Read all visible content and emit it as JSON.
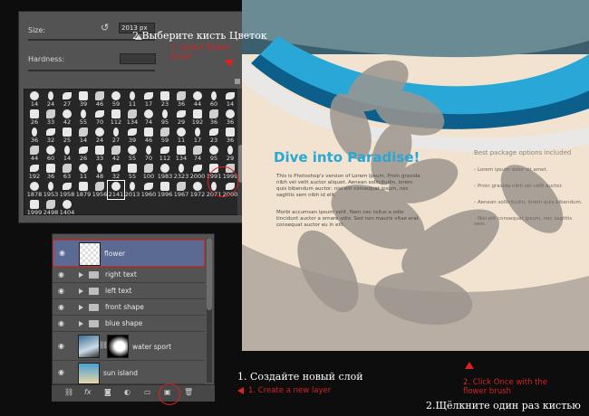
{
  "brush_panel": {
    "size_label": "Size:",
    "size_value": "2013 px",
    "hardness_label": "Hardness:",
    "brush_tips": [
      {
        "num": "14"
      },
      {
        "num": "24"
      },
      {
        "num": "27"
      },
      {
        "num": "39"
      },
      {
        "num": "46"
      },
      {
        "num": "59"
      },
      {
        "num": "11"
      },
      {
        "num": "17"
      },
      {
        "num": "23"
      },
      {
        "num": "36"
      },
      {
        "num": "44"
      },
      {
        "num": "60"
      },
      {
        "num": "14"
      },
      {
        "num": "26"
      },
      {
        "num": "33"
      },
      {
        "num": "42"
      },
      {
        "num": "55"
      },
      {
        "num": "70"
      },
      {
        "num": "112"
      },
      {
        "num": "134"
      },
      {
        "num": "74"
      },
      {
        "num": "95"
      },
      {
        "num": "29"
      },
      {
        "num": "192"
      },
      {
        "num": "36"
      },
      {
        "num": "36"
      },
      {
        "num": "36"
      },
      {
        "num": "32"
      },
      {
        "num": "25"
      },
      {
        "num": "14"
      },
      {
        "num": "24"
      },
      {
        "num": "27"
      },
      {
        "num": "39"
      },
      {
        "num": "46"
      },
      {
        "num": "59"
      },
      {
        "num": "11"
      },
      {
        "num": "17"
      },
      {
        "num": "23"
      },
      {
        "num": "36"
      },
      {
        "num": "44"
      },
      {
        "num": "60"
      },
      {
        "num": "14"
      },
      {
        "num": "26"
      },
      {
        "num": "33"
      },
      {
        "num": "42"
      },
      {
        "num": "55"
      },
      {
        "num": "70"
      },
      {
        "num": "112"
      },
      {
        "num": "134"
      },
      {
        "num": "74"
      },
      {
        "num": "95"
      },
      {
        "num": "29"
      },
      {
        "num": "192"
      },
      {
        "num": "36"
      },
      {
        "num": "63"
      },
      {
        "num": "11"
      },
      {
        "num": "48"
      },
      {
        "num": "32"
      },
      {
        "num": "55"
      },
      {
        "num": "100"
      },
      {
        "num": "1983"
      },
      {
        "num": "2323"
      },
      {
        "num": "2000"
      },
      {
        "num": "1991"
      },
      {
        "num": "1999"
      },
      {
        "num": "1878"
      },
      {
        "num": "1953"
      },
      {
        "num": "1958"
      },
      {
        "num": "1879"
      },
      {
        "num": "1956"
      },
      {
        "num": "2141"
      },
      {
        "num": "2013"
      },
      {
        "num": "1960"
      },
      {
        "num": "1996"
      },
      {
        "num": "1967"
      },
      {
        "num": "1972"
      },
      {
        "num": "2071"
      },
      {
        "num": "2000"
      },
      {
        "num": "1999"
      },
      {
        "num": "2498"
      },
      {
        "num": "1404"
      }
    ],
    "selected_index": 70
  },
  "annotations": {
    "step2_ru_top": "2.Выберите кисть Цветок",
    "step2_en_top": "2. Select flower brush",
    "step1_ru": "1. Создайте новый слой",
    "step1_en": "1. Create a new layer",
    "step2_en_bottom": "2. Click Once with the flower brush",
    "step2_ru_bottom": "2.Щёлкните один раз кистью"
  },
  "layers": [
    {
      "name": "flower",
      "type": "layer",
      "selected": true
    },
    {
      "name": "right text",
      "type": "group"
    },
    {
      "name": "left text",
      "type": "group"
    },
    {
      "name": "front shape",
      "type": "group"
    },
    {
      "name": "blue shape",
      "type": "group"
    },
    {
      "name": "water sport",
      "type": "layer_mask"
    },
    {
      "name": "sun island",
      "type": "layer"
    }
  ],
  "canvas": {
    "headline": "Dive into Paradise!",
    "body_1": "This is Photoshop's version of Lorem Ipsum. Proin gravida nibh vel velit auctor aliquet. Aenean sollicitudin, lorem quis bibendum auctor, nisi elit consequat ipsum, nec sagittis sem nibh id elit.",
    "body_2": "Morbi accumsan ipsum velit. Nam nec tellus a odio tincidunt auctor a ornare odio. Sed non mauris vitae erat consequat auctor eu in elit.",
    "right_title": "Best package options included",
    "bullets": [
      "Lorem ipsum dolor sit amet.",
      "Proin gravida nibh vel velit auctor.",
      "Aenean sollicitudin, lorem quis bibendum.",
      "Nisi elit consequat ipsum, nec sagittis sem."
    ]
  },
  "colors": {
    "accent_red": "#e02020",
    "panel": "#535353",
    "canvas_bg": "#f1e3cf",
    "blue": "#29a7d6",
    "flower_gray": "#9d968f"
  }
}
